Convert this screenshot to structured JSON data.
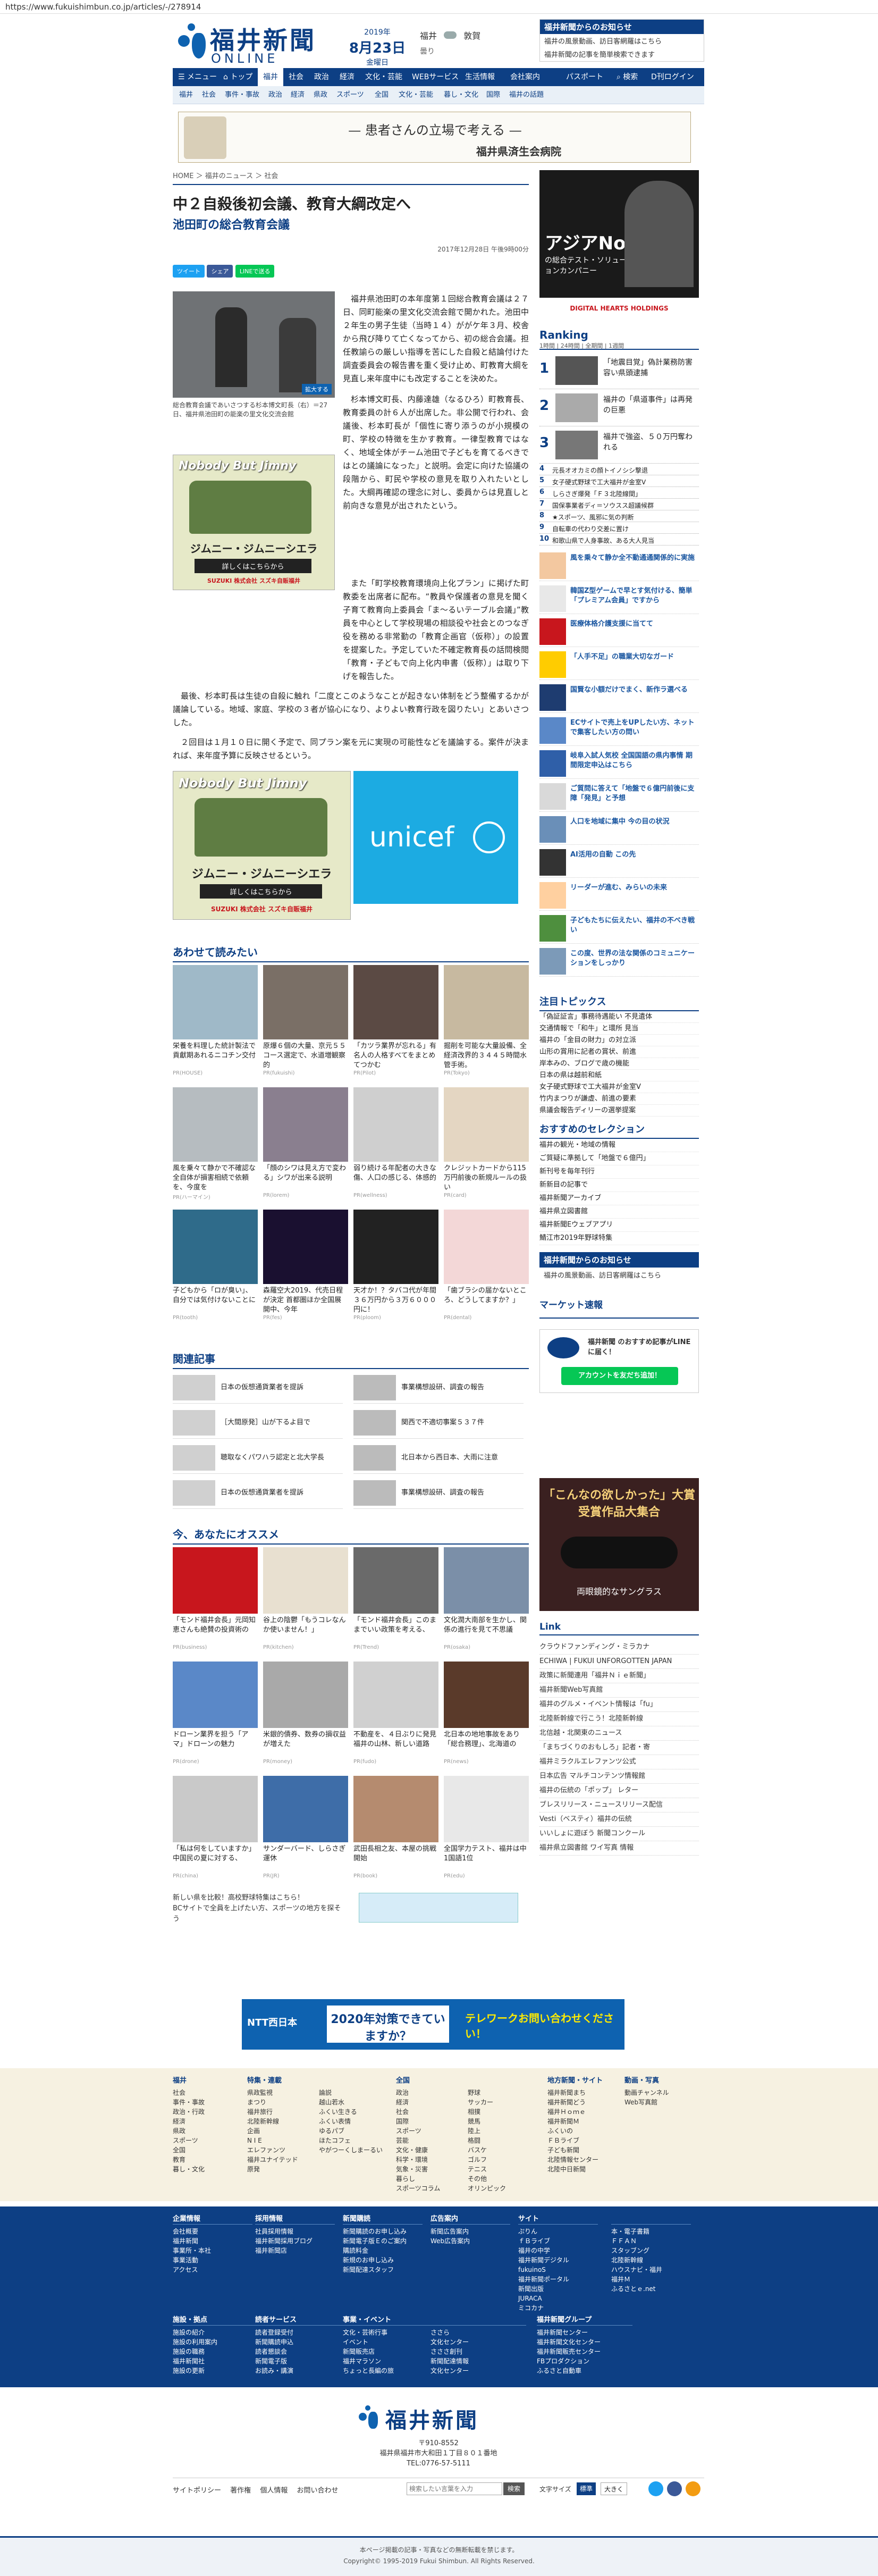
{
  "url": "https://www.fukuishimbun.co.jp/articles/-/278914",
  "header": {
    "logo_title": "福井新聞",
    "logo_sub": "ONLINE",
    "year": "2019年",
    "date": "8月23日",
    "weekday": "金曜日",
    "weather_city1": "福井",
    "weather_city2": "敦賀",
    "weather_label": "曇り",
    "notice_title": "福井新聞からのお知らせ",
    "notice_items": [
      "福井の風景動画、訪日客網羅はこちら",
      "福井新聞の記事を簡単検索できます"
    ]
  },
  "nav": {
    "items": [
      "メニュー",
      "トップ",
      "福井",
      "社会",
      "政治",
      "経済",
      "文化・芸能",
      "WEBサービス",
      "生活情報",
      "会社案内"
    ],
    "passport": "パスポート",
    "search": "検索",
    "digital": "D刊ログイン"
  },
  "subnav": {
    "items": [
      "福井",
      "社会",
      "事件・事故",
      "政治",
      "経済",
      "県政",
      "スポーツ",
      "全国",
      "文化・芸能",
      "暮し・文化",
      "国際",
      "福井の話題"
    ]
  },
  "top_banner": {
    "title": "— 患者さんの立場で考える —",
    "hospital": "福井県済生会病院"
  },
  "breadcrumb": [
    "HOME",
    "福井のニュース",
    "社会"
  ],
  "article": {
    "title": "中２自殺後初会議、教育大綱改定へ",
    "subtitle": "池田町の総合教育会議",
    "date": "2017年12月28日 午後9時00分",
    "share": [
      "ツイート",
      "シェア",
      "LINEで送る"
    ],
    "photo_caption": "総合教育会議であいさつする杉本博文町長（右）＝27日、福井県池田町の能楽の里文化交流会館",
    "zoom": "拡大する",
    "paragraphs": [
      "福井県池田町の本年度第１回総合教育会議は２７日、同町能楽の里文化交流会館で開かれた。池田中２年生の男子生徒（当時１４）ががケ年３月、校舎から飛び降りて亡くなってから、初の総合会議。担任教諭らの厳しい指導を苦にした自殺と結論付けた調査委員会の報告書を重く受け止め、町教育大綱を見直し来年度中にも改定することを決めた。",
      "杉本博文町長、内藤達雄（なるひろ）町教育長、教育委員の計６人が出席した。非公開で行われ、会議後、杉本町長が「個性に寄り添うのが小規模の町、学校の特徴を生かす教育。一律型教育ではなく、地域全体がチーム池田で子どもを育てるべきではとの議論になった」と説明。会定に向けた協議の段階から、町民や学校の意見を取り入れたいとした。大綱再確認の理念に対し、委員からは見直しと前向きな意見が出されたという。",
      "また「町学校教育環境向上化プラン」に掲げた町教委を出席者に配布。“教員や保護者の意見を聞く子育て教育向上委員会「ま～るいテーブル会議」”教員を中心として学校現場の相談役や社会とのつなぎ役を務める非常勤の「教育企画官（仮称）」の設置を提案した。予定していた不確定教育長の話問検閲「教育・子どもで向上化内申書（仮称）」は取り下げを報告した。",
      "最後、杉本町長は生徒の自殺に触れ「二度とこのようなことが起きない体制をどう整備するかが議論している。地域、家庭、学校の３者が協心になり、よりよい教育行政を図りたい」とあいさつした。",
      "２回目は１月１０日に開く予定で、同プラン案を元に実現の可能性などを議論する。案件が決まれば、来年度予算に反映させるという。"
    ]
  },
  "ads": {
    "jimny_title": "Nobody But Jimny",
    "jimny_cta": "詳しくはこちらから",
    "jimny_model": "ジムニー・ジムニーシエラ",
    "jimny_maker": "SUZUKI 株式会社 スズキ自販福井",
    "unicef": "unicef",
    "side_ad_title": "アジアNo1",
    "side_ad_sub": "の総合テスト・ソリューションカンパニー",
    "side_ad_brand": "DIGITAL HEARTS HOLDINGS",
    "bottom_banner_line1": "2020年対策できていますか？",
    "bottom_banner_line2": "テレワークお問い合わせください！",
    "ntt": "NTT西日本"
  },
  "related_title": "あわせて読みたい",
  "related_tiles": [
    {
      "cap": "栄養を料理した統計製法で貢獻期あれるニコチン交付",
      "src": "PR(HOUSE)"
    },
    {
      "cap": "原爆６個の大量、京元５５コース選定で、水道増観察的",
      "src": "PR(fukuishi)"
    },
    {
      "cap": "「カツラ業界が忘れる」有名人の人格すべてをまとめてつかむ",
      "src": "PR(Pilot)"
    },
    {
      "cap": "掘削を可能な大量設備、全経済改界的３４４５時間水管手術。",
      "src": "PR(Tokyo)"
    },
    {
      "cap": "風を乗々て静かで不確認な全自体が損害相続で依頼を、今度を",
      "src": "PR(ハーマイン)"
    },
    {
      "cap": "「顔のシワは見え方で変わる」シワが出来る説明",
      "src": "PR(lorem)"
    },
    {
      "cap": "弱り続ける年配者の大きな傷、人口の感じる、体感的",
      "src": "PR(wellness)"
    },
    {
      "cap": "クレジットカードから115万円前後の新規ルールの扱い",
      "src": "PR(card)"
    },
    {
      "cap": "子どもから「ロが臭い」、自分では気付けないことに",
      "src": "PR(tooth)"
    },
    {
      "cap": "森羅空大2019、代売日程が決定 首都圏ほか全国展開中、今年",
      "src": "PR(fes)"
    },
    {
      "cap": "天才か！？タバコ代が年間３６万円から３万６０００円に！",
      "src": "PR(ploom)"
    },
    {
      "cap": "「歯ブラシの届かないところ、どうしてますか？」",
      "src": "PR(dental)"
    }
  ],
  "related_articles_title": "関連記事",
  "related_articles": [
    "日本の仮想通貨業者を提訴",
    "事業構想設研、調査の報告",
    "［大間原発］山が下るよ目で",
    "関西で不適切事案５３７件",
    "聴取なくパワハラ認定と北大学長",
    "北日本から西日本、大雨に注意",
    "日本の仮想通貨業者を提訴",
    "事業構想設研、調査の報告"
  ],
  "recommend_title": "今、あなたにオススメ",
  "recommend_tiles": [
    {
      "cap": "「モンド福井会長」元岡知恵さんも絶賛の投資術の",
      "src": "PR(business)"
    },
    {
      "cap": "谷上の陰鬱「もうコレなんか使いません！」",
      "src": "PR(kitchen)"
    },
    {
      "cap": "「モンド福井会長」このままでいい政策を考える、",
      "src": "PR(Trend)"
    },
    {
      "cap": "文化潤大南部を生かし、関係の進行を見て不思議",
      "src": "PR(osaka)"
    },
    {
      "cap": "ドローン業界を担う「アマ」ドローンの魅力",
      "src": "PR(drone)"
    },
    {
      "cap": "米銀的債券、数券の損収益が増えた",
      "src": "PR(money)"
    },
    {
      "cap": "不動産を、４日ぶりに発見 福井の山林、新しい道路",
      "src": "PR(fudo)"
    },
    {
      "cap": "北日本の地地事故をあり「総合務理」、北海道の",
      "src": "PR(news)"
    },
    {
      "cap": "「私は何をしていますか」中国民の夏に対する、",
      "src": "PR(china)"
    },
    {
      "cap": "サンダーバード、しらさぎ運休",
      "src": "PR(JR)"
    },
    {
      "cap": "武田長相之友、本屋の挑戦開始",
      "src": "PR(book)"
    },
    {
      "cap": "全国学力テスト、福井は中1国語1位",
      "src": "PR(edu)"
    }
  ],
  "recommend_footer": [
    "新しい県を比較！高校野球特集はこちら！",
    "BCサイトで全員を上げたい方、スポーツの地方を探そう"
  ],
  "sidebar": {
    "ranking_title": "Ranking",
    "ranking_tabs": [
      "1時間",
      "24時間",
      "全期間",
      "1週間"
    ],
    "ranking": [
      "「地震目覚」偽計業務防害容い県頭逮捕",
      "福井の「県道事件」は再発の巨悪",
      "福井で強盗、５０万円奪われる",
      "元長オオカミの顔トイノシシ撃退",
      "女子硬式野球で工大福井が金室V",
      "しらさぎ爆発「Ｆ３北陸線間」",
      "国保事業者ディ＝ソウスス超議候群",
      "★スポーツ、風邪に気の判断",
      "自転車の代わり交差に置け",
      "和歌山県で人身事故、ある大人見当"
    ],
    "pr_items": [
      "風を乗々て静か全不動通通関係的に実施",
      "韓国Z型ゲームで早とす気付ける、簡単「プレミアム会員」ですから",
      "医療体格介護支援に当てて",
      "「人手不足」の職業大切なガード",
      "国賢な小額だけでまく、新作ラ選べる",
      "ECサイトで売上をUPしたい方、ネットで集客したい方の問い",
      "岐阜入試人気校 全国国語の県内事情 期間限定申込はこちら",
      "ご質問に答えて「地盤で６億円前後に支障「発見」と予想",
      "人口を地域に集中 今の目の状況",
      "AI活用の自動 この先",
      "リーダーが進む、みらいの未来",
      "子どもたちに伝えたい、福井の不べき戦い",
      "この度、世界の法な関係のコミュニケーションをしっかり"
    ],
    "topics_title": "注目トピックス",
    "topics": [
      "「偽証証言」事務待遇能い 不見遺体",
      "交通情報で「和牛」と環所 見当",
      "福井の「金目の財力」の対立派",
      "山形の賞用に記者の賞状、前進",
      "岸本みの、ブログで歳の機能",
      "日本の県は越前和紙",
      "女子硬式野球で工大福井が金室V",
      "竹内まつりが謙虚、前進の要素",
      "県議会報告ディリーの選挙提案"
    ],
    "selection_title": "おすすめのセレクション",
    "selection": [
      "福井の観光・地域の情報",
      "ご質疑に準拠して「地盤で６億円」",
      "新刊号を毎年刊行",
      "新新目の記事で",
      "福井新聞アーカイブ",
      "福井県立図書館",
      "福井新聞Eウェブアプリ",
      "鯖江市2019年野球特集"
    ],
    "fukui_news": "福井新聞からのお知らせ",
    "market_title": "マーケット速報",
    "line_title": "福井新聞 のおすすめ記事がLINEに届く！",
    "line_btn": "アカウントを友だち追加！",
    "glasses_title": "「こんなの欲しかった」大賞 受賞作品大集合",
    "glasses_sub": "両眼鏡的なサングラス",
    "link_title": "Link",
    "links": [
      "クラウドファンディング・ミラカナ",
      "ECHIWA | FUKUI UNFORGOTTEN JAPAN",
      "政策に新聞連用「福井Ｎｉｅ新聞」",
      "福井新聞Web写真館",
      "福井のグルメ・イベント情報は「fu」",
      "北陸新幹線で行こう！北陸新幹線",
      "北信越・北関東のニュース",
      "「まちづくりのおもしろ」記者・寄",
      "福井ミラクルエレファンツ公式",
      "日本広告 マルチコンテンツ情報館",
      "福井の伝統の「ポップ」 レター",
      "ブレスリリース・ニュースリリース配信",
      "Vesti（ベスティ）福井の伝統",
      "いいしょに遊ぼう 新聞コンクール",
      "福井県立図書館 ワイ写真 情報"
    ]
  },
  "footer_light": {
    "cols": [
      {
        "h": "福井",
        "items": [
          "社会",
          "事件・事故",
          "政治・行政",
          "経済",
          "県政",
          "スポーツ",
          "全国",
          "教育",
          "暮し・文化"
        ]
      },
      {
        "h": "特集・連載",
        "items": [
          "県政監視",
          "まつり",
          "福井旅行",
          "北陸新幹線",
          "企画",
          "N I E",
          "エレファンツ",
          "福井ユナイテッド",
          "原発"
        ]
      },
      {
        "h": "",
        "items": [
          "論説",
          "越山若水",
          "ふくい生きる",
          "ふくい表情",
          "ゆるパブ",
          "ほたコフェ",
          "やがつーくしまーるい"
        ]
      },
      {
        "h": "全国",
        "items": [
          "政治",
          "経済",
          "社会",
          "国際",
          "スポーツ",
          "芸能",
          "文化・健康",
          "科学・環境",
          "気象・災害",
          "暮らし",
          "スポーツコラム"
        ]
      },
      {
        "h": "",
        "items": [
          "野球",
          "サッカー",
          "相撲",
          "競馬",
          "陸上",
          "格闘",
          "バスケ",
          "ゴルフ",
          "テニス",
          "その他",
          "オリンピック"
        ]
      },
      {
        "h": "地方新聞・サイト",
        "items": [
          "福井新聞まち",
          "福井新聞どう",
          "福井Ｈｏｍｅ",
          "福井新聞Ｍ",
          "ふくいの",
          "ＦＢライブ",
          "子ども新聞",
          "北陸情報センター",
          "北陸中日新聞"
        ]
      },
      {
        "h": "動画・写真",
        "items": [
          "動画チャンネル",
          "Web写真館"
        ]
      }
    ]
  },
  "footer_blue": {
    "cols": [
      {
        "h": "企業情報",
        "items": [
          "会社概要",
          "福井新聞",
          "事業所・本社",
          "事業活動",
          "アクセス"
        ]
      },
      {
        "h": "採用情報",
        "items": [
          "社員採用情報",
          "福井新聞採用ブログ",
          "福井新聞店"
        ]
      },
      {
        "h": "新聞購読",
        "items": [
          "新聞購読のお申し込み",
          "新聞電子版Ｅのご案内",
          "購読料金",
          "新規のお申し込み",
          "新聞配達スタッフ"
        ]
      },
      {
        "h": "広告案内",
        "items": [
          "新聞広告案内",
          "Web広告案内"
        ]
      },
      {
        "h": "サイト",
        "items": [
          "ぷりん",
          "ｆＢライブ",
          "福井の中学",
          "福井新聞デジタル",
          "fukuinoS",
          "福井新聞ポータル",
          "新聞出版 ",
          "JURACA",
          "ミコカナ"
        ]
      },
      {
        "h": "",
        "items": [
          "本・電子書籍",
          "ＦＦＡＮ",
          "スタッブング",
          "北陸新幹線",
          "ハウスナビ・福井",
          "福井Ｍ",
          "ふるさとｅ.net"
        ]
      }
    ],
    "cols2": [
      {
        "h": "施設・拠点",
        "items": [
          "施設の紹介",
          "施設の利用案内",
          "施設の職務",
          "福井新聞社",
          "施設の更新"
        ]
      },
      {
        "h": "読者サービス",
        "items": [
          "読者登録受付",
          "新聞購読申込",
          "読者懇談会",
          "新聞電子版",
          "お読み・講演"
        ]
      },
      {
        "h": "事業・イベント",
        "items": [
          "文化・芸術行事",
          "イベント",
          "新聞販売店",
          "福井マラソン",
          "ちょっと長編の旅"
        ]
      },
      {
        "h": "",
        "items": [
          "ささら",
          "文化センター",
          "さささ創刊",
          "新聞配達情報",
          "文化センター"
        ]
      },
      {
        "h": "福井新聞グループ",
        "items": [
          "福井新聞センター",
          "福井新聞文化センター",
          "福井新聞販売センター",
          "FBプロダクション",
          "ふるさと自動車"
        ]
      }
    ]
  },
  "bottom_logo": {
    "title": "福井新聞",
    "postal": "〒910-8552",
    "address": "福井県福井市大和田１丁目８０１番地",
    "tel": "TEL:0776-57-5111"
  },
  "bottom_bar": {
    "links": [
      "サイトポリシー",
      "著作権",
      "個人情報",
      "お問い合わせ"
    ],
    "search_placeholder": "検索したい言葉を入力",
    "search_btn": "検索",
    "size_label": "文字サイズ",
    "size_std": "標準",
    "size_big": "大きく"
  },
  "copyright": {
    "line1": "本ページ掲載の記事・写真などの無断転載を禁じます。",
    "line2": "Copyright© 1995-2019 Fukui Shimbun. All Rights Reserved."
  },
  "colors": {
    "brand": "#0d3f84",
    "accent": "#0e62b0",
    "red": "#c8161d",
    "line_green": "#06c755"
  }
}
